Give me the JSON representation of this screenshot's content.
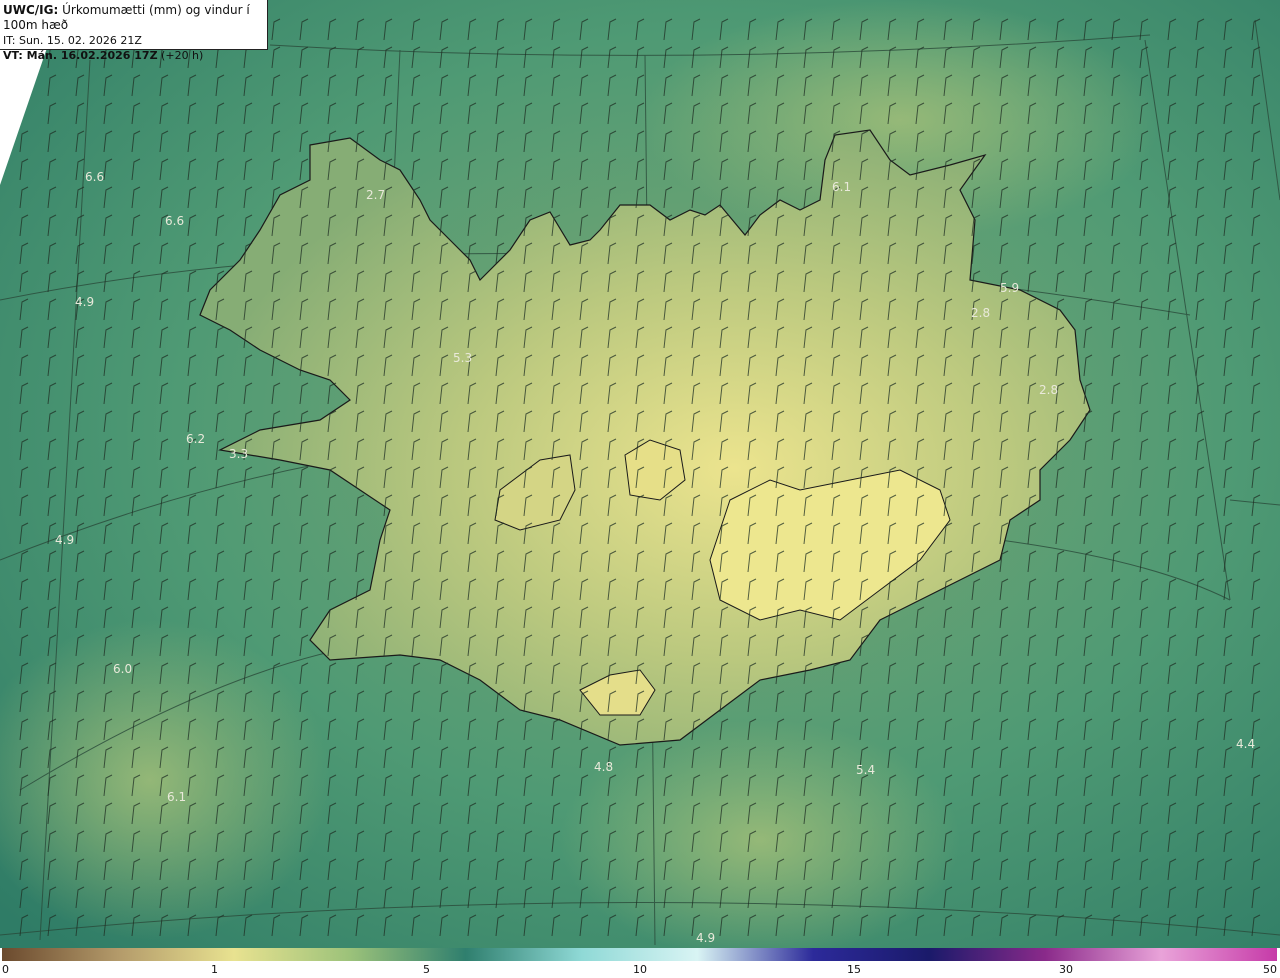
{
  "header": {
    "title_prefix": "UWC/IG:",
    "title_rest": " Úrkomumætti (mm) og vindur í 100m hæð",
    "issue_time": "IT: Sun. 15. 02. 2026 21Z",
    "valid_prefix": "VT: Mán. 16.02.2026 17Z",
    "valid_rest": " (+20 h)"
  },
  "value_labels": [
    {
      "text": "6.6"
    },
    {
      "text": "6.6"
    },
    {
      "text": "4.9"
    },
    {
      "text": "6.2"
    },
    {
      "text": "3.3"
    },
    {
      "text": "4.9"
    },
    {
      "text": "6.0"
    },
    {
      "text": "6.1"
    },
    {
      "text": "2.7"
    },
    {
      "text": "5.3"
    },
    {
      "text": "6.1"
    },
    {
      "text": "5.9"
    },
    {
      "text": "2.8"
    },
    {
      "text": "2.8"
    },
    {
      "text": "4.8"
    },
    {
      "text": "5.4"
    },
    {
      "text": "4.4"
    },
    {
      "text": "4.9"
    }
  ],
  "colorbar": {
    "ticks": [
      "0",
      "1",
      "5",
      "10",
      "15",
      "30",
      "50"
    ],
    "colors": [
      "#6b4a2e",
      "#b39a6a",
      "#e8e290",
      "#9cc27a",
      "#2f7f6e",
      "#8fd9d6",
      "#d9f4f4",
      "#2c2a9a",
      "#1a1a6a",
      "#8a2a8a",
      "#e9a3d9",
      "#c63aa8"
    ]
  },
  "colors": {
    "ocean": "#3e8a6a",
    "land_low": "#8fb277",
    "land_high": "#e8e08a",
    "coast": "#1a1a1a"
  }
}
